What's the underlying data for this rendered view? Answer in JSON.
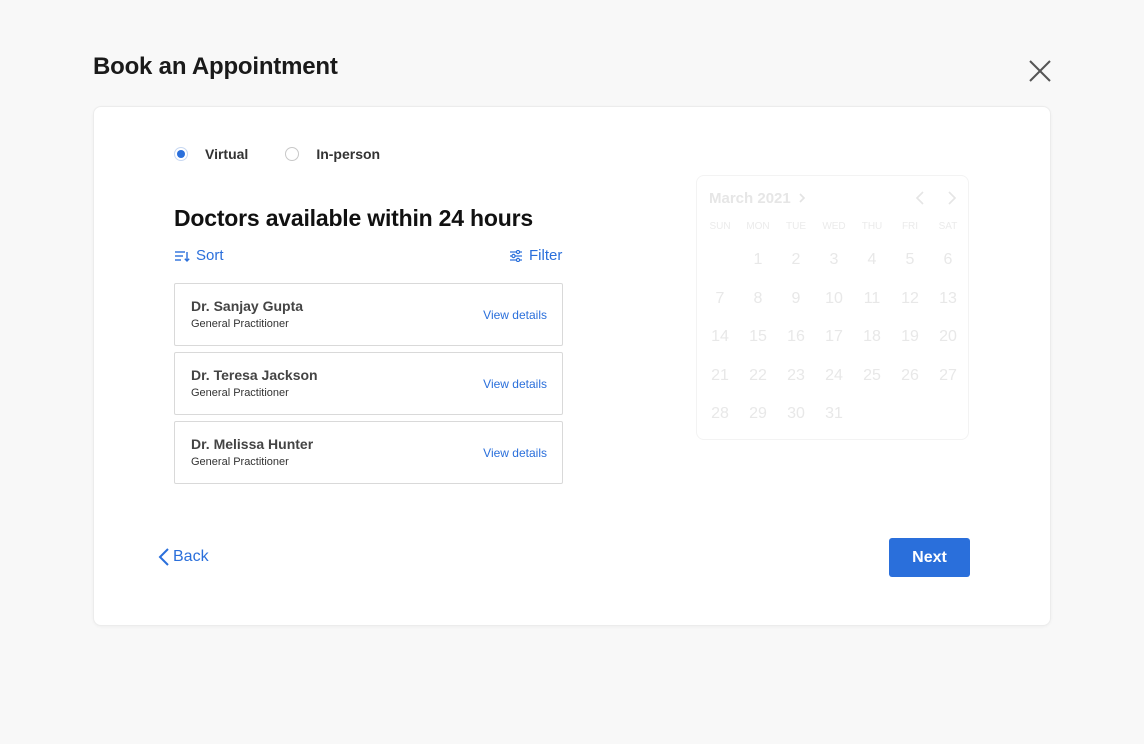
{
  "dialog": {
    "title": "Book an Appointment"
  },
  "visit_type": {
    "options": [
      {
        "label": "Virtual",
        "checked": true
      },
      {
        "label": "In-person",
        "checked": false
      }
    ]
  },
  "doctors": {
    "heading": "Doctors available within 24 hours",
    "sort_label": "Sort",
    "filter_label": "Filter",
    "link_label": "View details",
    "items": [
      {
        "name": "Dr. Sanjay Gupta",
        "specialty": "General Practitioner"
      },
      {
        "name": "Dr. Teresa Jackson",
        "specialty": "General Practitioner"
      },
      {
        "name": "Dr. Melissa Hunter",
        "specialty": "General Practitioner"
      }
    ]
  },
  "calendar": {
    "month_label": "March 2021",
    "weekdays": [
      "SUN",
      "MON",
      "TUE",
      "WED",
      "THU",
      "FRI",
      "SAT"
    ],
    "weeks": [
      [
        "",
        "1",
        "2",
        "3",
        "4",
        "5",
        "6"
      ],
      [
        "7",
        "8",
        "9",
        "10",
        "11",
        "12",
        "13"
      ],
      [
        "14",
        "15",
        "16",
        "17",
        "18",
        "19",
        "20"
      ],
      [
        "21",
        "22",
        "23",
        "24",
        "25",
        "26",
        "27"
      ],
      [
        "28",
        "29",
        "30",
        "31",
        "",
        "",
        ""
      ]
    ]
  },
  "footer": {
    "back_label": "Back",
    "next_label": "Next"
  },
  "colors": {
    "accent": "#2a6fdb",
    "background": "#f8f8f8",
    "card": "#ffffff"
  }
}
